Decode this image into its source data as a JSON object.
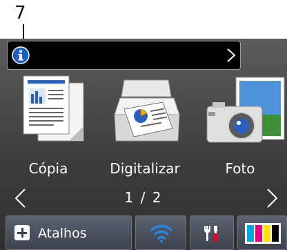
{
  "callout": {
    "number": "7"
  },
  "info_bar": {
    "icon": "info-icon",
    "chevron": "chevron-right-icon"
  },
  "tiles": [
    {
      "label": "Cópia",
      "icon": "copy-icon"
    },
    {
      "label": "Digitalizar",
      "icon": "scanner-icon"
    },
    {
      "label": "Foto",
      "icon": "photo-camera-icon"
    }
  ],
  "pager": {
    "current_label": "1 / 2",
    "prev_icon": "chevron-left-icon",
    "next_icon": "chevron-right-icon"
  },
  "dock": {
    "shortcuts_label": "Atalhos",
    "shortcuts_icon": "plus-icon",
    "wifi_icon": "wifi-icon",
    "settings_icon": "tools-icon",
    "ink_icon": "ink-cartridges-icon"
  },
  "colors": {
    "info_blue": "#1e5fc4",
    "wifi_blue": "#2a86e8",
    "ink_cyan": "#00a7e1",
    "ink_magenta": "#e6007e",
    "ink_yellow": "#ffe100",
    "ink_black": "#000000"
  }
}
